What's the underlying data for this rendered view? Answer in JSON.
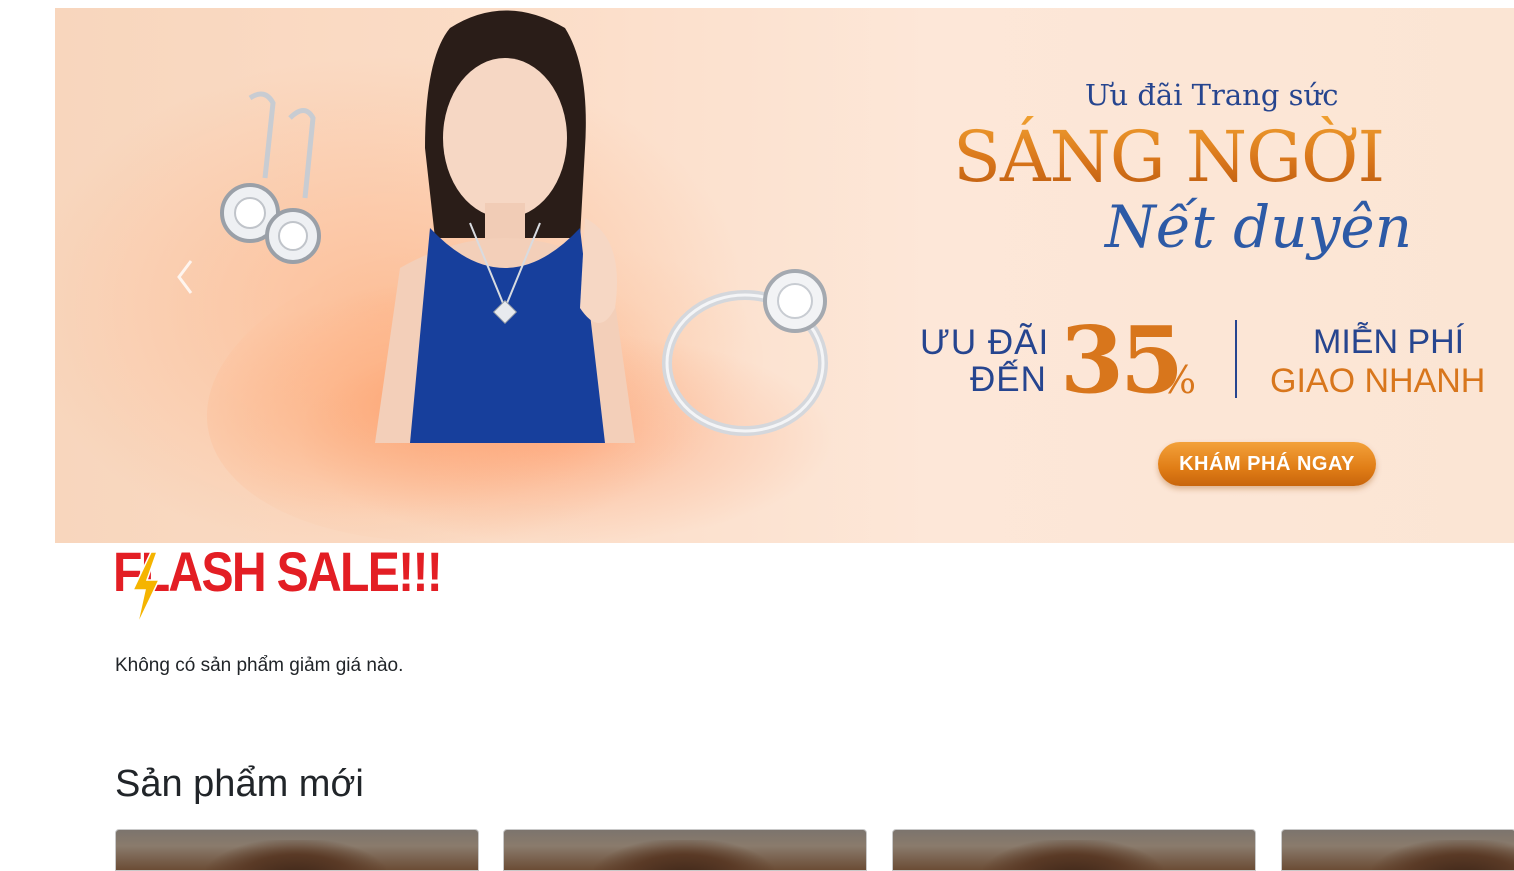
{
  "banner": {
    "subtitle": "Ưu đãi Trang sức",
    "title": "SÁNG NGỜI",
    "script_title": "Nết duyên",
    "deal_line1": "ƯU ĐÃI",
    "deal_line2": "ĐẾN",
    "deal_value": "35",
    "deal_unit": "%",
    "shipping_line1": "MIỄN PHÍ",
    "shipping_line2": "GIAO NHANH",
    "cta_label": "KHÁM PHÁ NGAY",
    "prev_icon": "chevron-left-icon",
    "colors": {
      "navy": "#26458f",
      "orange": "#d8761c",
      "background": "#fbdcc6"
    }
  },
  "flash_sale": {
    "title": "FLASH SALE!!!",
    "bolt_icon": "lightning-bolt-icon",
    "empty_message": "Không có sản phẩm giảm giá nào.",
    "color": "#e31e24"
  },
  "new_products": {
    "title": "Sản phẩm mới",
    "cards": [
      {
        "image": "product-model-photo"
      },
      {
        "image": "product-model-photo"
      },
      {
        "image": "product-model-photo"
      },
      {
        "image": "product-model-photo"
      }
    ]
  }
}
